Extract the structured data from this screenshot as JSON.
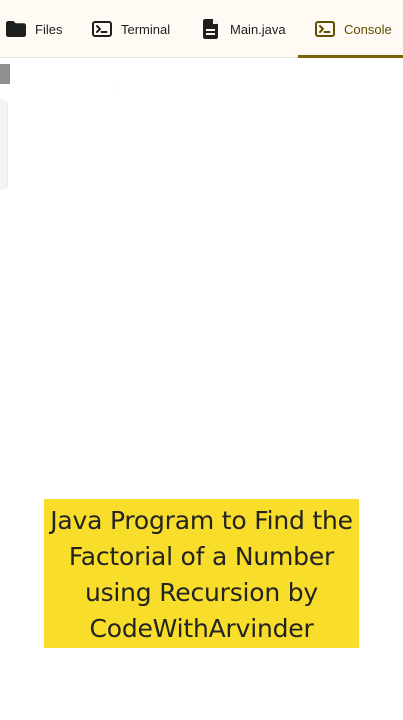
{
  "tabs": {
    "files": {
      "label": "Files",
      "icon": "folder-icon"
    },
    "terminal": {
      "label": "Terminal",
      "icon": "terminal-icon"
    },
    "main_java": {
      "label": "Main.java",
      "icon": "file-icon"
    },
    "console": {
      "label": "Console",
      "icon": "terminal-icon",
      "active": true
    }
  },
  "caption": {
    "text": "Java Program to Find the\nFactorial of a Number\nusing Recursion by\nCodeWithArvinder"
  },
  "colors": {
    "active_tab": "#7b6300",
    "caption_background": "#f8dd2b",
    "tab_bar_background": "#fffaf3"
  }
}
